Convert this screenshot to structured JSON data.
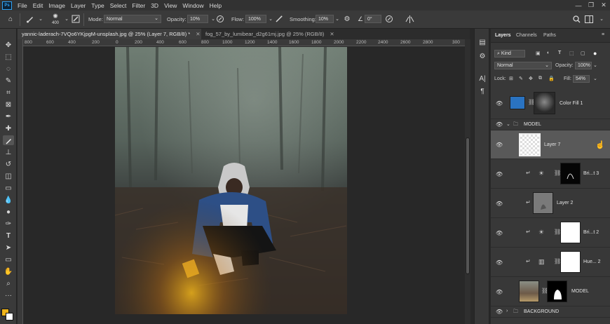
{
  "menu": {
    "app_icon": "Ps",
    "items": [
      "File",
      "Edit",
      "Image",
      "Layer",
      "Type",
      "Select",
      "Filter",
      "3D",
      "View",
      "Window",
      "Help"
    ]
  },
  "options": {
    "brush_size": "400",
    "mode_label": "Mode:",
    "mode_value": "Normal",
    "opacity_label": "Opacity:",
    "opacity_value": "10%",
    "flow_label": "Flow:",
    "flow_value": "100%",
    "smoothing_label": "Smoothing:",
    "smoothing_value": "10%",
    "angle_value": "0°"
  },
  "tabs": [
    {
      "title": "yannic-laderach-7VQo6YKjpgM-unsplash.jpg @ 25% (Layer 7, RGB/8) *"
    },
    {
      "title": "fog_57_by_lumibear_d2g61mj.jpg @ 25% (RGB/8)"
    }
  ],
  "ruler": [
    "800",
    "600",
    "400",
    "200",
    "0",
    "200",
    "400",
    "600",
    "800",
    "1000",
    "1200",
    "1400",
    "1600",
    "1800",
    "2000",
    "2200",
    "2400",
    "2600",
    "2800",
    "300"
  ],
  "colors": {
    "foreground": "#f0b41a",
    "background": "#ffffff",
    "accent": "#2fa3f7"
  },
  "layers_panel": {
    "tabs": [
      "Layers",
      "Channels",
      "Paths"
    ],
    "kind_label": "Kind",
    "blend_mode": "Normal",
    "opacity_label": "Opacity:",
    "opacity_value": "100%",
    "lock_label": "Lock:",
    "fill_label": "Fill:",
    "fill_value": "54%",
    "layers": [
      {
        "name": "Color Fill 1",
        "type": "fill"
      },
      {
        "name": "MODEL",
        "type": "group"
      },
      {
        "name": "Layer 7",
        "type": "pixel",
        "selected": true
      },
      {
        "name": "Bri...t 3",
        "type": "adjustment"
      },
      {
        "name": "Layer 2",
        "type": "pixel"
      },
      {
        "name": "Bri...t 2",
        "type": "adjustment"
      },
      {
        "name": "Hue... 2",
        "type": "adjustment"
      },
      {
        "name": "MODEL",
        "type": "pixel"
      },
      {
        "name": "BACKGROUND",
        "type": "group"
      }
    ]
  }
}
